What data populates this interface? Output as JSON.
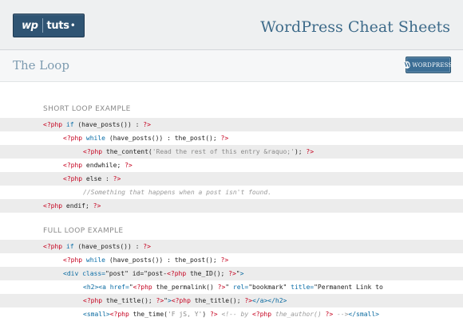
{
  "header": {
    "logo_wp": "wp",
    "logo_tuts": "tuts",
    "logo_dot": "•",
    "title": "WordPress Cheat Sheets"
  },
  "subheader": {
    "title": "The Loop",
    "badge_icon": "W",
    "badge_text": "WORDPRESS"
  },
  "short_example": {
    "heading": "SHORT LOOP EXAMPLE",
    "lines": [
      {
        "indent": 0,
        "tokens": [
          [
            "php",
            "<?php"
          ],
          [
            "kw",
            " if"
          ],
          [
            "plain",
            " (have_posts()) : "
          ],
          [
            "php",
            "?>"
          ]
        ]
      },
      {
        "indent": 1,
        "tokens": [
          [
            "php",
            "<?php"
          ],
          [
            "kw",
            " while"
          ],
          [
            "plain",
            " (have_posts()) : the_post(); "
          ],
          [
            "php",
            "?>"
          ]
        ]
      },
      {
        "indent": 2,
        "tokens": [
          [
            "php",
            "<?php"
          ],
          [
            "plain",
            " the_content("
          ],
          [
            "str",
            "'Read the rest of this entry &raquo;'"
          ],
          [
            "plain",
            "); "
          ],
          [
            "php",
            "?>"
          ]
        ]
      },
      {
        "indent": 1,
        "tokens": [
          [
            "php",
            "<?php"
          ],
          [
            "plain",
            " endwhile; "
          ],
          [
            "php",
            "?>"
          ]
        ]
      },
      {
        "indent": 1,
        "tokens": [
          [
            "php",
            "<?php"
          ],
          [
            "plain",
            " else : "
          ],
          [
            "php",
            "?>"
          ]
        ]
      },
      {
        "indent": 2,
        "tokens": [
          [
            "comment",
            "//Something that happens when a post isn't found."
          ]
        ]
      },
      {
        "indent": 0,
        "tokens": [
          [
            "php",
            "<?php"
          ],
          [
            "plain",
            " endif; "
          ],
          [
            "php",
            "?>"
          ]
        ]
      }
    ]
  },
  "full_example": {
    "heading": "FULL LOOP EXAMPLE",
    "lines": [
      {
        "indent": 0,
        "tokens": [
          [
            "php",
            "<?php"
          ],
          [
            "kw",
            " if"
          ],
          [
            "plain",
            " (have_posts()) : "
          ],
          [
            "php",
            "?>"
          ]
        ]
      },
      {
        "indent": 1,
        "tokens": [
          [
            "php",
            "<?php"
          ],
          [
            "kw",
            " while"
          ],
          [
            "plain",
            " (have_posts()) : the_post(); "
          ],
          [
            "php",
            "?>"
          ]
        ]
      },
      {
        "indent": 1,
        "tokens": [
          [
            "tag",
            "<div"
          ],
          [
            "kw",
            " class="
          ],
          [
            "attrval",
            "\"post\""
          ],
          [
            "plain",
            " id="
          ],
          [
            "attrval",
            "\"post-"
          ],
          [
            "php",
            "<?php"
          ],
          [
            "plain",
            " the_ID(); "
          ],
          [
            "php",
            "?>"
          ],
          [
            "attrval",
            "\""
          ],
          [
            "tag",
            ">"
          ]
        ]
      },
      {
        "indent": 2,
        "tokens": [
          [
            "tag",
            "<h2><a"
          ],
          [
            "kw",
            " href="
          ],
          [
            "attrval",
            "\""
          ],
          [
            "php",
            "<?php"
          ],
          [
            "plain",
            " the_permalink() "
          ],
          [
            "php",
            "?>"
          ],
          [
            "attrval",
            "\""
          ],
          [
            "kw",
            " rel="
          ],
          [
            "attrval",
            "\"bookmark\""
          ],
          [
            "kw",
            " title="
          ],
          [
            "attrval",
            "\"Permanent Link to"
          ]
        ]
      },
      {
        "indent": 2,
        "tokens": [
          [
            "php",
            "<?php"
          ],
          [
            "plain",
            " the_title(); "
          ],
          [
            "php",
            "?>"
          ],
          [
            "attrval",
            "\""
          ],
          [
            "tag",
            ">"
          ],
          [
            "php",
            "<?php"
          ],
          [
            "plain",
            " the_title(); "
          ],
          [
            "php",
            "?>"
          ],
          [
            "tag",
            "</a></h2>"
          ]
        ]
      },
      {
        "indent": 2,
        "tokens": [
          [
            "tag",
            "<small>"
          ],
          [
            "php",
            "<?php"
          ],
          [
            "plain",
            " the_time("
          ],
          [
            "str",
            "'F jS, Y'"
          ],
          [
            "plain",
            ") "
          ],
          [
            "php",
            "?>"
          ],
          [
            "comment",
            " <!-- by "
          ],
          [
            "php",
            "<?php"
          ],
          [
            "comment",
            " the_author() "
          ],
          [
            "php",
            "?>"
          ],
          [
            "comment",
            " -->"
          ],
          [
            "tag",
            "</small>"
          ]
        ]
      }
    ]
  },
  "colors": {
    "header_bg": "#eef0f1",
    "title_blue": "#3e6b8a",
    "logo_bg": "#2f5473",
    "php_red": "#c5001e",
    "keyword_blue": "#0b6ea8",
    "code_shade": "#ececec"
  }
}
